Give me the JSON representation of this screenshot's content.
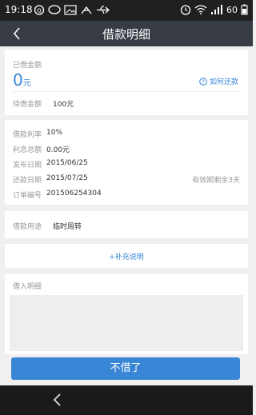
{
  "status_bar": {
    "time": "19:18",
    "battery": "60"
  },
  "header": {
    "title": "借款明细"
  },
  "summary": {
    "borrowed_label": "已借金额",
    "borrowed_amount": "0",
    "borrowed_unit": "元",
    "how_to_repay": "如何还款",
    "pending_label": "待借金额",
    "pending_value": "100元"
  },
  "details": [
    {
      "label": "借款利率",
      "value": "10%",
      "note": ""
    },
    {
      "label": "利息总额",
      "value": "0.00元",
      "note": ""
    },
    {
      "label": "发布日期",
      "value": "2015/06/25",
      "note": ""
    },
    {
      "label": "还款日期",
      "value": "2015/07/25",
      "note": "有效期剩余3天"
    },
    {
      "label": "订单编号",
      "value": "201506254304",
      "note": ""
    }
  ],
  "purpose": {
    "label": "借款用途",
    "value": "临时周转"
  },
  "supplement": {
    "label": "+补充说明"
  },
  "borrow_detail": {
    "label": "借入明细"
  },
  "submit": {
    "label": "不借了"
  },
  "colors": {
    "accent": "#3a86d6",
    "nav": "#373b44"
  }
}
